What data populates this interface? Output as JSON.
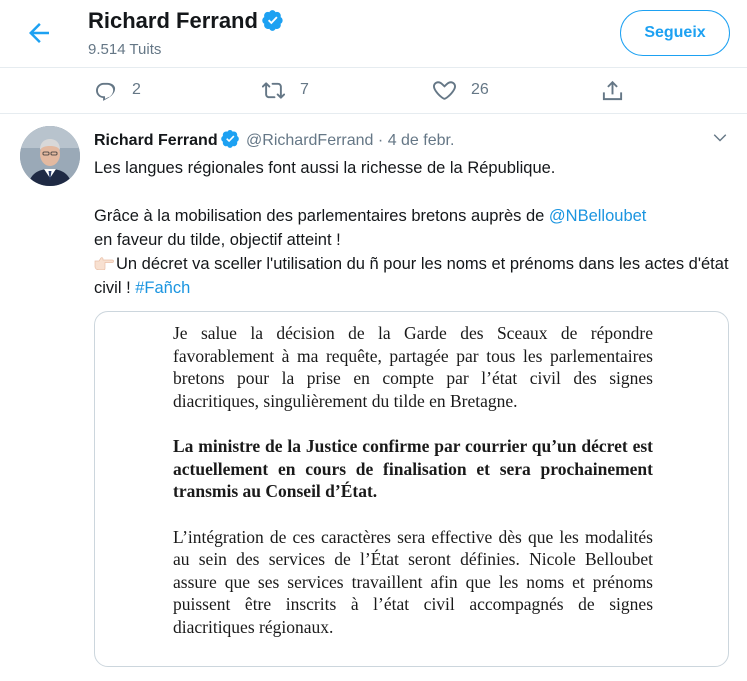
{
  "header": {
    "back_icon": "arrow-left-icon",
    "name": "Richard Ferrand",
    "verified_icon": "verified-badge-icon",
    "tweet_count": "9.514 Tuits",
    "follow_label": "Segueix"
  },
  "actions": {
    "reply": {
      "icon": "reply-icon",
      "count": "2"
    },
    "retweet": {
      "icon": "retweet-icon",
      "count": "7"
    },
    "like": {
      "icon": "heart-icon",
      "count": "26"
    },
    "share": {
      "icon": "share-icon"
    }
  },
  "tweet": {
    "name": "Richard Ferrand",
    "handle": "@RichardFerrand",
    "separator": "·",
    "date": "4 de febr.",
    "line1": "Les langues régionales font aussi la richesse de la République.",
    "line2_pre": "Grâce à la mobilisation des parlementaires bretons auprès de ",
    "mention": "@NBelloubet",
    "line2_post": " en faveur du tilde, objectif atteint !",
    "line3": "Un décret va sceller l'utilisation du ñ pour les noms et prénoms dans les actes d'état civil ! ",
    "hashtag": "#Fañch",
    "emoji_icon": "pointing-right-emoji-icon"
  },
  "document": {
    "p1": "Je salue la décision de la Garde des Sceaux de répondre favorablement à ma requête, partagée par tous les parlementaires bretons pour la prise en compte par l’état civil des signes diacritiques, singulièrement du tilde en Bretagne.",
    "p2": "La ministre de la Justice confirme par courrier qu’un décret est actuellement en cours de finalisation et sera prochainement transmis au Conseil d’État.",
    "p3": "L’intégration de ces caractères sera effective dès que les modalités au sein des services de l’État seront définies. Nicole Belloubet assure que ses services travaillent afin que les noms et prénoms puissent être inscrits à l’état civil accompagnés de signes diacritiques régionaux."
  },
  "colors": {
    "accent": "#1da1f2",
    "link": "#1b95e0",
    "muted": "#657786",
    "border": "#e6ecf0"
  }
}
